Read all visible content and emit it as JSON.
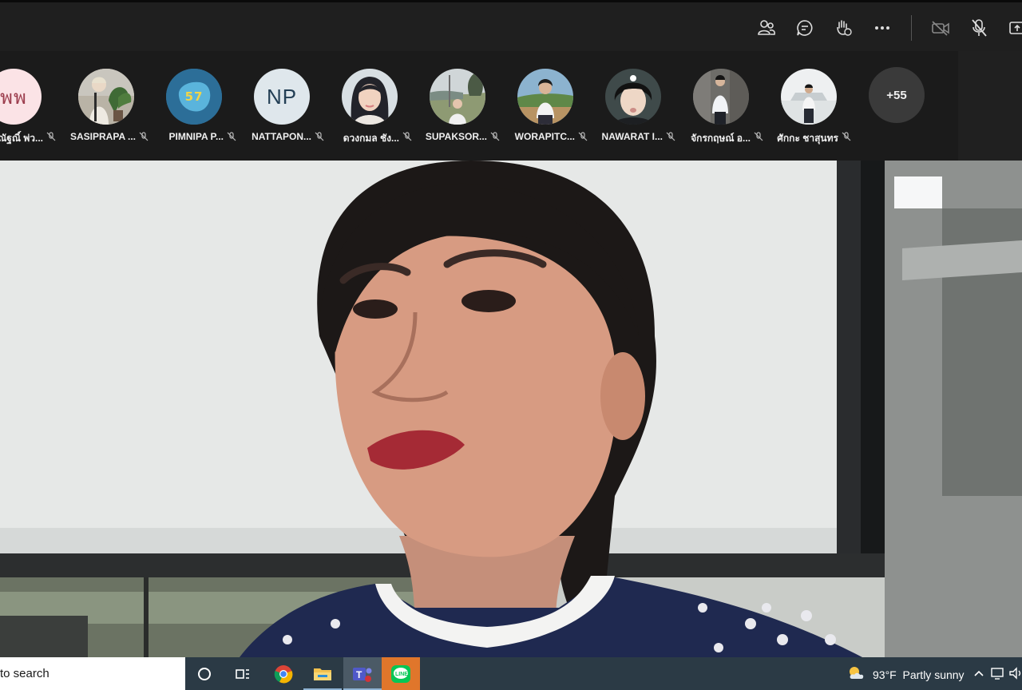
{
  "toolbar": {
    "buttons": [
      {
        "name": "people-icon"
      },
      {
        "name": "chat-icon"
      },
      {
        "name": "raise-hand-icon"
      },
      {
        "name": "more-options-icon"
      },
      {
        "name": "camera-off-icon"
      },
      {
        "name": "mic-off-icon"
      },
      {
        "name": "share-icon"
      }
    ]
  },
  "participants": [
    {
      "initials": "พพ",
      "name": "ณัฐณิ์ พ่ว..."
    },
    {
      "name": "SASIPRAPA ..."
    },
    {
      "initials": "57",
      "name": "PIMNIPA P..."
    },
    {
      "initials": "NP",
      "name": "NATTAPON..."
    },
    {
      "name": "ดวงกมล ชัง..."
    },
    {
      "name": "SUPAKSOR..."
    },
    {
      "name": "WORAPITC..."
    },
    {
      "name": "NAWARAT I..."
    },
    {
      "name": "จักรกฤษณ์ อ..."
    },
    {
      "name": "ศักกะ ชาสุนทร"
    }
  ],
  "overflow_count": "+55",
  "colors": {
    "toolbar_bg": "#1f1f1f",
    "strip_bg": "#1b1b1b",
    "taskbar_bg": "#2b3a45",
    "initials_pw_bg": "#fbe3e6",
    "initials_57_bg": "#2c6e98",
    "initials_np_bg": "#dfe7ec"
  },
  "taskbar": {
    "search_text": "to search",
    "apps": [
      "cortana-icon",
      "task-view-icon",
      "chrome-icon",
      "file-explorer-icon",
      "teams-icon",
      "line-icon"
    ],
    "temperature": "93°F",
    "weather": "Partly sunny"
  }
}
